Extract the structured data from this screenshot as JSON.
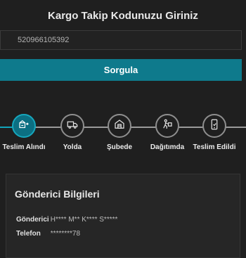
{
  "header": {
    "title": "Kargo Takip Kodunuzu Giriniz"
  },
  "search": {
    "value": "520966105392"
  },
  "query_button": {
    "label": "Sorgula"
  },
  "steps": [
    {
      "label": "Teslim Alındı",
      "icon": "package-received-icon",
      "active": true
    },
    {
      "label": "Yolda",
      "icon": "truck-icon",
      "active": false
    },
    {
      "label": "Şubede",
      "icon": "branch-building-icon",
      "active": false
    },
    {
      "label": "Dağıtımda",
      "icon": "courier-icon",
      "active": false
    },
    {
      "label": "Teslim Edildi",
      "icon": "delivered-phone-icon",
      "active": false
    }
  ],
  "sender_card": {
    "title": "Gönderici Bilgileri",
    "rows": [
      {
        "key": "Gönderici",
        "value": "H**** M** K**** S*****"
      },
      {
        "key": "Telefon",
        "value": "********78"
      }
    ]
  },
  "colors": {
    "accent": "#0e7a8c",
    "active_ring": "#16a7bd",
    "background": "#1f1f1f"
  }
}
